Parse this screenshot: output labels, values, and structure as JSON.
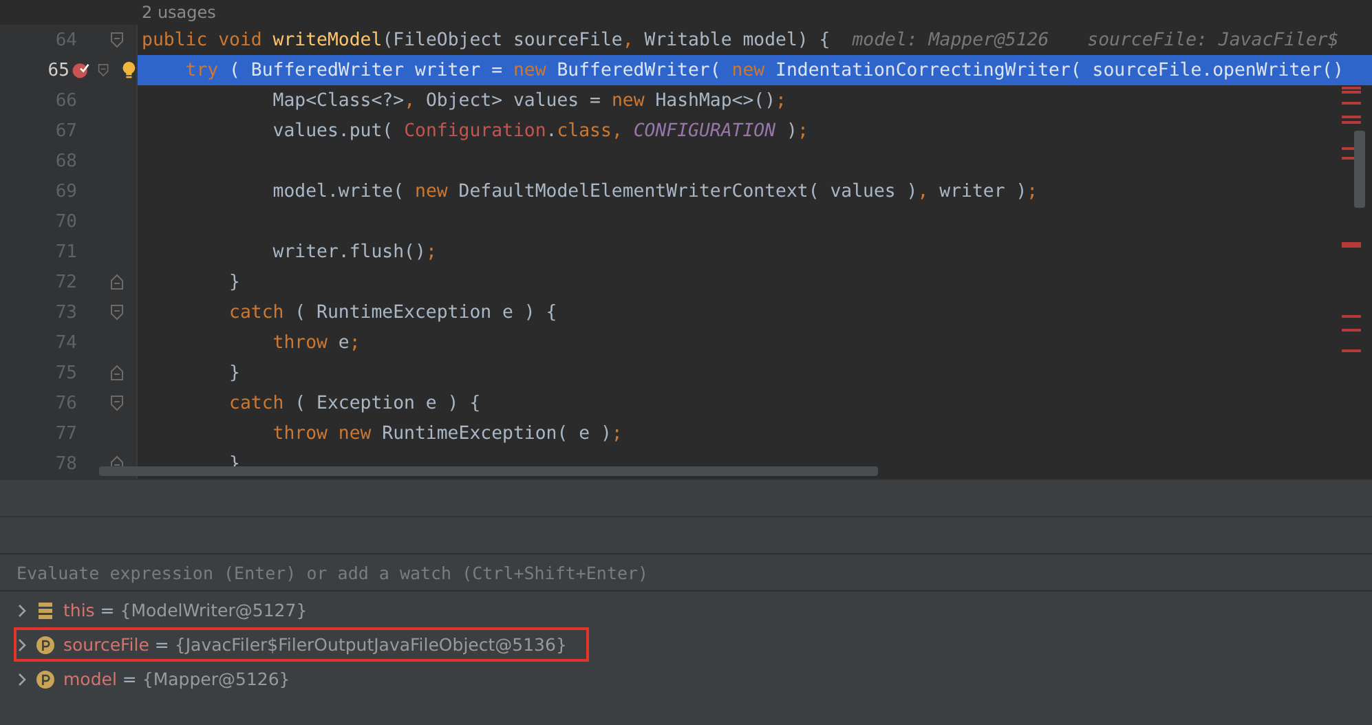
{
  "editor": {
    "usages": "2 usages",
    "lines": [
      {
        "number": "64",
        "selected": false,
        "breakpoint": false,
        "bulb": false,
        "kind": "block-start",
        "code": [
          {
            "kind": "kw",
            "text": "public void "
          },
          {
            "kind": "method",
            "text": "writeModel"
          },
          {
            "kind": "plain",
            "text": "(FileObject sourceFile"
          },
          {
            "kind": "punct",
            "text": ", "
          },
          {
            "kind": "plain",
            "text": "Writable model) {"
          }
        ],
        "hints": [
          "model: Mapper@5126",
          "sourceFile: JavacFiler$"
        ]
      },
      {
        "number": "65",
        "selected": true,
        "breakpoint": true,
        "bulb": true,
        "kind": "block-start",
        "code": [
          {
            "kind": "kw",
            "text": "    try"
          },
          {
            "kind": "plain",
            "text": " ( BufferedWriter writer = "
          },
          {
            "kind": "kw",
            "text": "new"
          },
          {
            "kind": "plain",
            "text": " BufferedWriter( "
          },
          {
            "kind": "kw",
            "text": "new"
          },
          {
            "kind": "plain",
            "text": " IndentationCorrectingWriter( sourceFile.openWriter()"
          }
        ]
      },
      {
        "number": "66",
        "selected": false,
        "breakpoint": false,
        "bulb": false,
        "code": [
          {
            "kind": "plain",
            "text": "            Map<Class<?>"
          },
          {
            "kind": "punct",
            "text": ", "
          },
          {
            "kind": "plain",
            "text": "Object> values = "
          },
          {
            "kind": "kw",
            "text": "new"
          },
          {
            "kind": "plain",
            "text": " HashMap<>()"
          },
          {
            "kind": "punct",
            "text": ";"
          }
        ]
      },
      {
        "number": "67",
        "selected": false,
        "breakpoint": false,
        "bulb": false,
        "code": [
          {
            "kind": "plain",
            "text": "            values.put( "
          },
          {
            "kind": "type",
            "text": "Configuration"
          },
          {
            "kind": "plain",
            "text": "."
          },
          {
            "kind": "kw",
            "text": "class"
          },
          {
            "kind": "punct",
            "text": ", "
          },
          {
            "kind": "const",
            "text": "CONFIGURATION"
          },
          {
            "kind": "plain",
            "text": " )"
          },
          {
            "kind": "punct",
            "text": ";"
          }
        ]
      },
      {
        "number": "68",
        "selected": false,
        "breakpoint": false,
        "bulb": false
      },
      {
        "number": "69",
        "selected": false,
        "breakpoint": false,
        "bulb": false,
        "code": [
          {
            "kind": "plain",
            "text": "            model.write( "
          },
          {
            "kind": "kw",
            "text": "new"
          },
          {
            "kind": "plain",
            "text": " DefaultModelElementWriterContext( values )"
          },
          {
            "kind": "punct",
            "text": ", "
          },
          {
            "kind": "plain",
            "text": "writer )"
          },
          {
            "kind": "punct",
            "text": ";"
          }
        ]
      },
      {
        "number": "70",
        "selected": false,
        "breakpoint": false,
        "bulb": false
      },
      {
        "number": "71",
        "selected": false,
        "breakpoint": false,
        "bulb": false,
        "code": [
          {
            "kind": "plain",
            "text": "            writer.flush()"
          },
          {
            "kind": "punct",
            "text": ";"
          }
        ]
      },
      {
        "number": "72",
        "selected": false,
        "breakpoint": false,
        "bulb": false,
        "kind": "block-end",
        "code": [
          {
            "kind": "plain",
            "text": "        }"
          }
        ]
      },
      {
        "number": "73",
        "selected": false,
        "breakpoint": false,
        "bulb": false,
        "kind": "block-start",
        "code": [
          {
            "kind": "kw",
            "text": "        catch"
          },
          {
            "kind": "plain",
            "text": " ( RuntimeException e ) {"
          }
        ]
      },
      {
        "number": "74",
        "selected": false,
        "breakpoint": false,
        "bulb": false,
        "code": [
          {
            "kind": "kw",
            "text": "            throw"
          },
          {
            "kind": "plain",
            "text": " e"
          },
          {
            "kind": "punct",
            "text": ";"
          }
        ]
      },
      {
        "number": "75",
        "selected": false,
        "breakpoint": false,
        "bulb": false,
        "kind": "block-end",
        "code": [
          {
            "kind": "plain",
            "text": "        }"
          }
        ]
      },
      {
        "number": "76",
        "selected": false,
        "breakpoint": false,
        "bulb": false,
        "kind": "block-start",
        "code": [
          {
            "kind": "kw",
            "text": "        catch"
          },
          {
            "kind": "plain",
            "text": " ( Exception e ) {"
          }
        ]
      },
      {
        "number": "77",
        "selected": false,
        "breakpoint": false,
        "bulb": false,
        "code": [
          {
            "kind": "kw",
            "text": "            throw new"
          },
          {
            "kind": "plain",
            "text": " RuntimeException( e )"
          },
          {
            "kind": "punct",
            "text": ";"
          }
        ]
      },
      {
        "number": "78",
        "selected": false,
        "breakpoint": false,
        "bulb": false,
        "kind": "block-end",
        "code": [
          {
            "kind": "plain",
            "text": "        }"
          }
        ]
      }
    ]
  },
  "debugger": {
    "evaluate": {
      "placeholder": "Evaluate expression (Enter) or add a watch (Ctrl+Shift+Enter)"
    },
    "variables": [
      {
        "kind": "field",
        "name": "this",
        "equals": "=",
        "value": "{ModelWriter@5127}",
        "highlighted": false
      },
      {
        "kind": "param",
        "name": "sourceFile",
        "equals": "=",
        "value": "{JavacFiler$FilerOutputJavaFileObject@5136}",
        "highlighted": true
      },
      {
        "kind": "param",
        "name": "model",
        "equals": "=",
        "value": "{Mapper@5126}",
        "highlighted": false
      }
    ]
  }
}
